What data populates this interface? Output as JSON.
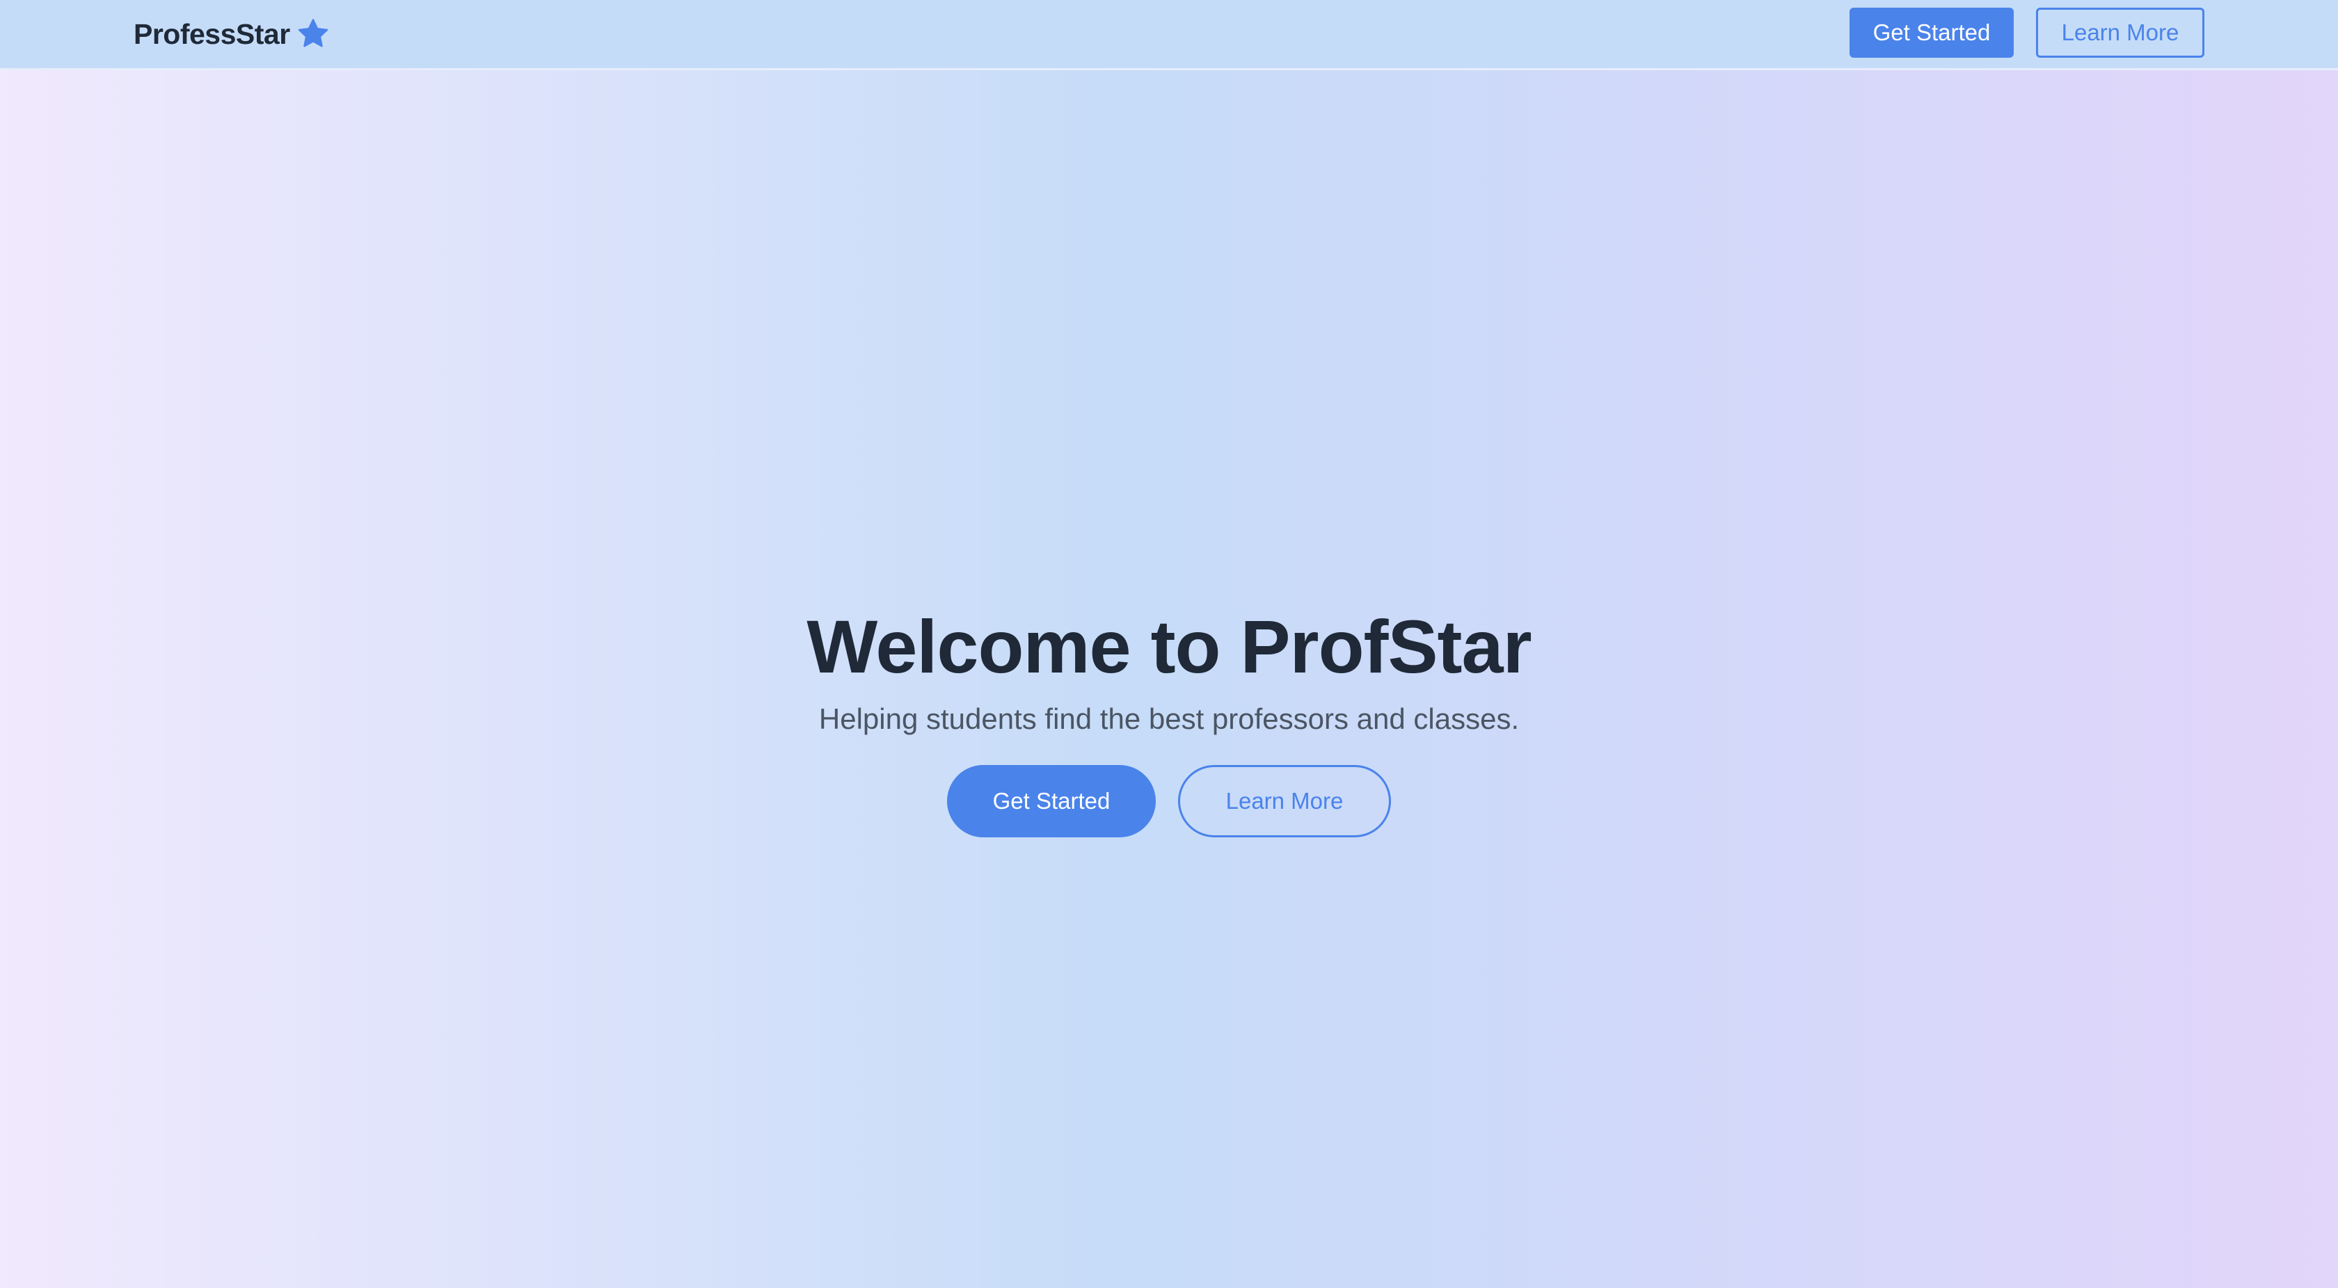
{
  "navbar": {
    "brand_name": "ProfessStar",
    "brand_icon": "star-icon",
    "get_started_label": "Get Started",
    "learn_more_label": "Learn More"
  },
  "hero": {
    "title": "Welcome to ProfStar",
    "subtitle": "Helping students find the best professors and classes.",
    "get_started_label": "Get Started",
    "learn_more_label": "Learn More"
  },
  "colors": {
    "accent": "#4a83ea",
    "navbar_bg": "#c5dcf9",
    "text_dark": "#1f2937",
    "text_muted": "#4b5563"
  }
}
